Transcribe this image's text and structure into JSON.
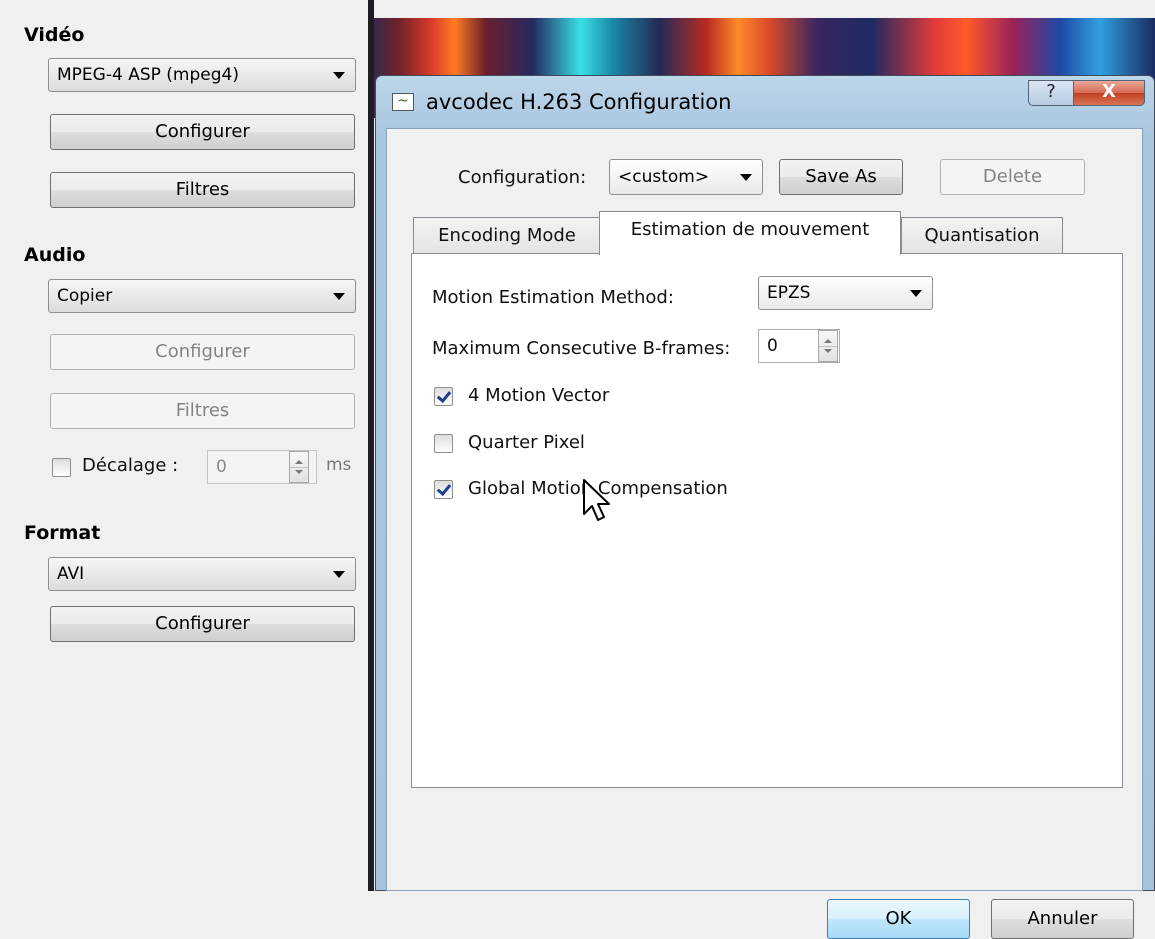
{
  "left_panel": {
    "video": {
      "title": "Vidéo",
      "codec": "MPEG-4 ASP (mpeg4)",
      "configure_label": "Configurer",
      "filters_label": "Filtres"
    },
    "audio": {
      "title": "Audio",
      "codec": "Copier",
      "configure_label": "Configurer",
      "filters_label": "Filtres",
      "offset_label": "Décalage :",
      "offset_value": "0",
      "offset_unit": "ms"
    },
    "format": {
      "title": "Format",
      "container": "AVI",
      "configure_label": "Configurer"
    }
  },
  "dialog": {
    "title": "avcodec H.263 Configuration",
    "help_label": "?",
    "close_label": "X",
    "configuration_label": "Configuration:",
    "configuration_value": "<custom>",
    "save_as_label": "Save As",
    "delete_label": "Delete",
    "tabs": [
      {
        "label": "Encoding Mode"
      },
      {
        "label": "Estimation de mouvement"
      },
      {
        "label": "Quantisation"
      }
    ],
    "active_tab": "Estimation de mouvement",
    "motion": {
      "method_label": "Motion Estimation Method:",
      "method_value": "EPZS",
      "bframes_label": "Maximum Consecutive B-frames:",
      "bframes_value": "0",
      "four_mv_label": "4 Motion Vector",
      "four_mv_checked": true,
      "qpel_label": "Quarter Pixel",
      "qpel_checked": false,
      "gmc_label": "Global Motion Compensation",
      "gmc_checked": true
    },
    "ok_label": "OK",
    "cancel_label": "Annuler"
  }
}
